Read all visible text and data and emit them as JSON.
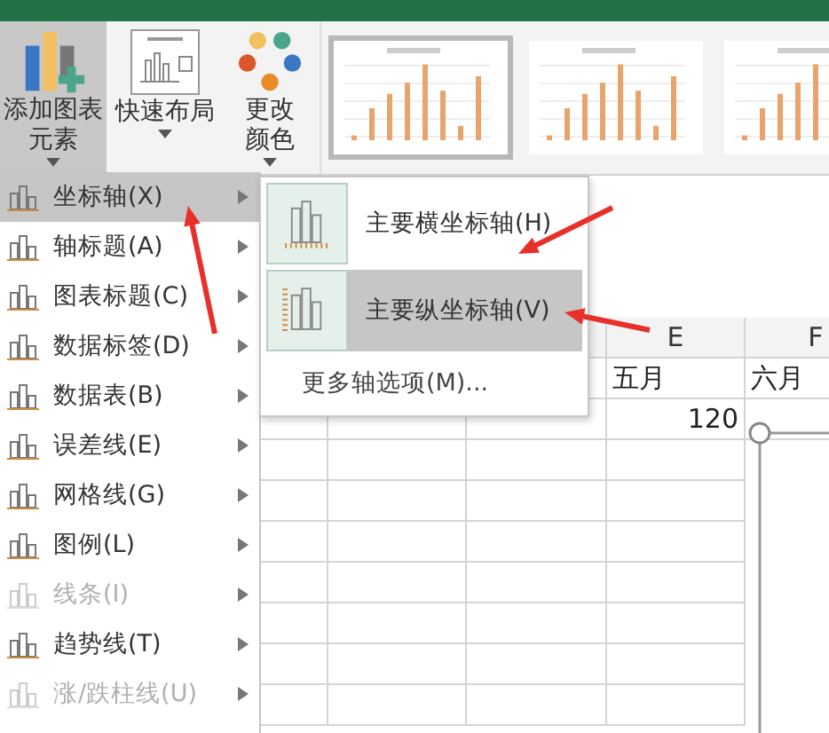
{
  "ribbon": {
    "buttons": [
      {
        "label": "添加图表元素",
        "selected": true
      },
      {
        "label": "快速布局",
        "selected": false
      },
      {
        "label": "更改颜色",
        "selected": false
      }
    ],
    "styles": [
      {
        "selected": true
      },
      {
        "selected": false
      },
      {
        "selected": false
      }
    ]
  },
  "sheet": {
    "columns": [
      {
        "label": "E"
      },
      {
        "label": "F"
      }
    ],
    "rows": [
      [
        "五月",
        "六月"
      ],
      [
        "120"
      ]
    ]
  },
  "menu": {
    "items": [
      {
        "label": "坐标轴(X)",
        "selected": true,
        "disabled": false
      },
      {
        "label": "轴标题(A)",
        "selected": false,
        "disabled": false
      },
      {
        "label": "图表标题(C)",
        "selected": false,
        "disabled": false
      },
      {
        "label": "数据标签(D)",
        "selected": false,
        "disabled": false
      },
      {
        "label": "数据表(B)",
        "selected": false,
        "disabled": false
      },
      {
        "label": "误差线(E)",
        "selected": false,
        "disabled": false
      },
      {
        "label": "网格线(G)",
        "selected": false,
        "disabled": false
      },
      {
        "label": "图例(L)",
        "selected": false,
        "disabled": false
      },
      {
        "label": "线条(I)",
        "selected": false,
        "disabled": true
      },
      {
        "label": "趋势线(T)",
        "selected": false,
        "disabled": false
      },
      {
        "label": "涨/跌柱线(U)",
        "selected": false,
        "disabled": true
      }
    ]
  },
  "submenu": {
    "items": [
      {
        "label": "主要横坐标轴(H)",
        "selected": false
      },
      {
        "label": "主要纵坐标轴(V)",
        "selected": true
      }
    ],
    "more": "更多轴选项(M)..."
  }
}
